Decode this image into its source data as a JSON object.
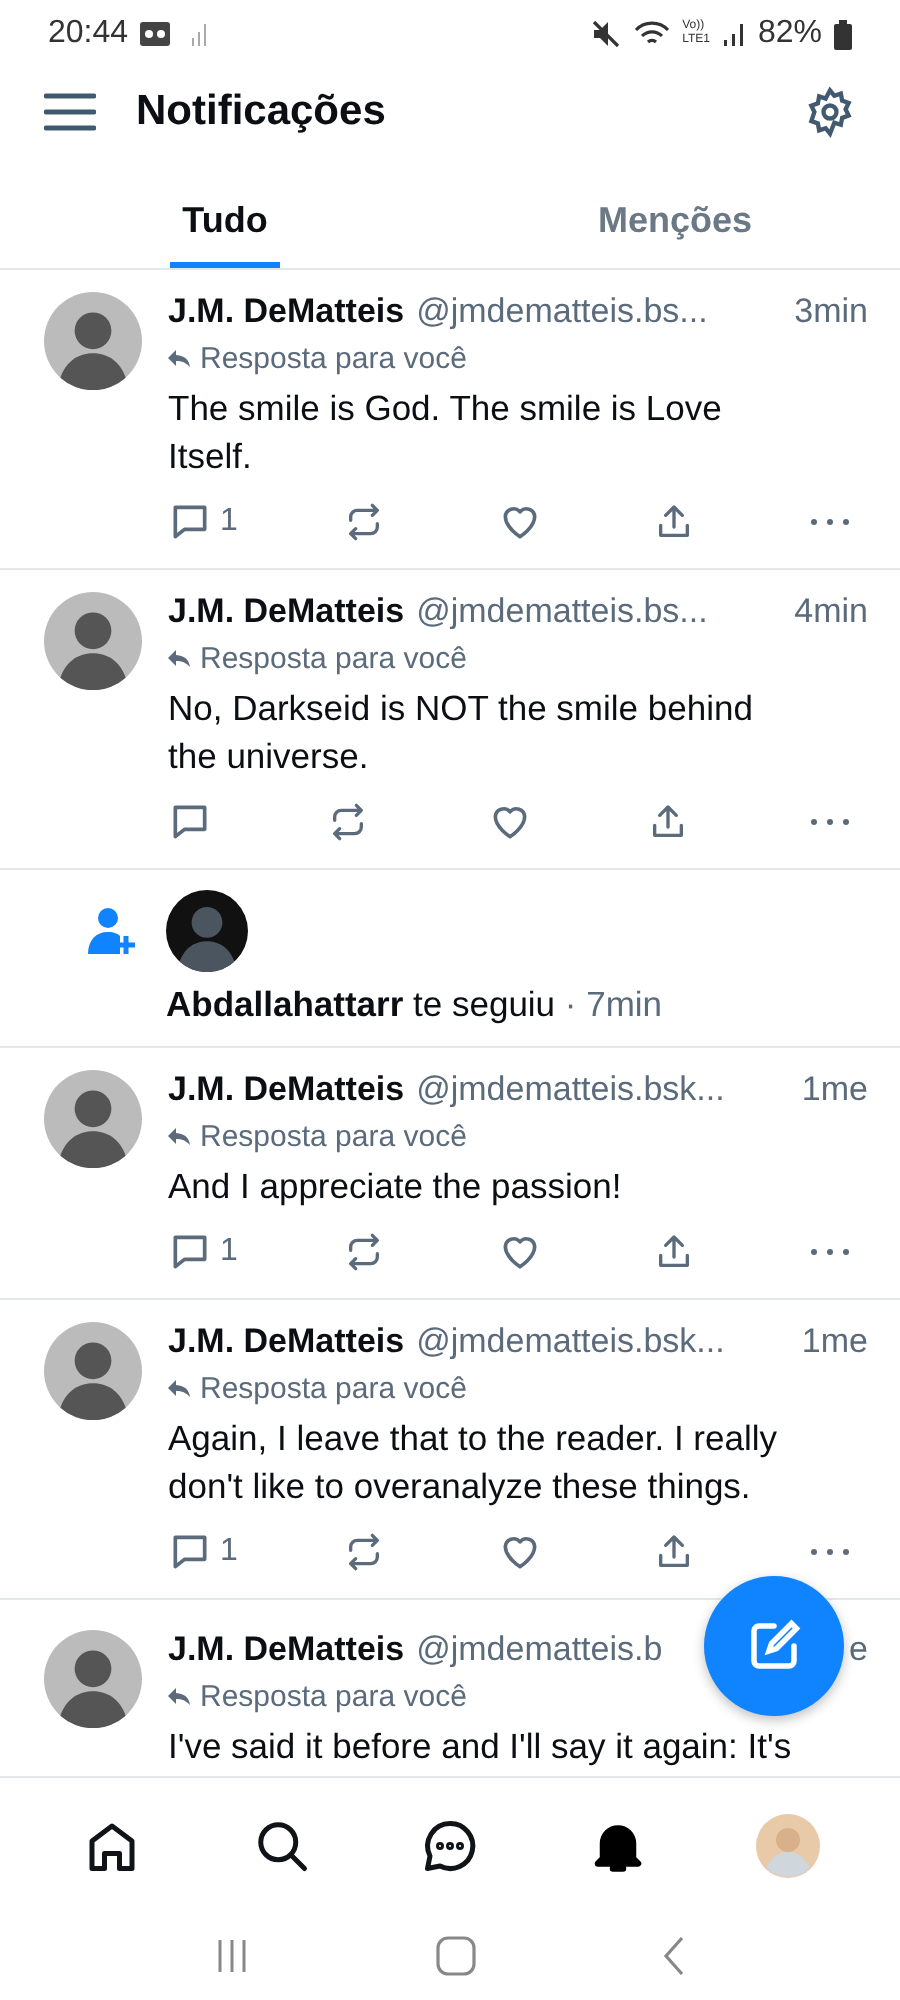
{
  "status_bar": {
    "time": "20:44",
    "volte_top": "Vo))",
    "volte_bottom": "LTE1",
    "battery": "82%"
  },
  "header": {
    "title": "Notificações"
  },
  "tabs": [
    {
      "label": "Tudo",
      "selected": true
    },
    {
      "label": "Menções",
      "selected": false
    }
  ],
  "feed": [
    {
      "kind": "post",
      "author": "J.M. DeMatteis",
      "handle": "@jmdematteis.bs...",
      "time": "3min",
      "context": "Resposta para você",
      "text": "The smile is God.  The smile is Love Itself.",
      "replies": "1"
    },
    {
      "kind": "post",
      "author": "J.M. DeMatteis",
      "handle": "@jmdematteis.bs...",
      "time": "4min",
      "context": "Resposta para você",
      "text": "No, Darkseid is NOT the smile behind the universe."
    },
    {
      "kind": "follow",
      "author": "Abdallahattarr",
      "action": "te seguiu",
      "time": "· 7min"
    },
    {
      "kind": "post",
      "author": "J.M. DeMatteis",
      "handle": "@jmdematteis.bsk...",
      "time": "1me",
      "context": "Resposta para você",
      "text": "And I appreciate the passion!",
      "replies": "1"
    },
    {
      "kind": "post",
      "author": "J.M. DeMatteis",
      "handle": "@jmdematteis.bsk...",
      "time": "1me",
      "context": "Resposta para você",
      "text": "Again, I leave that to the reader.  I really don't like to overanalyze these things.",
      "replies": "1"
    },
    {
      "kind": "cut",
      "author": "J.M. DeMatteis",
      "handle": "@jmdematteis.b",
      "time": "e",
      "context": "Resposta para você",
      "text": "I've said it before and I'll say it again: It's"
    }
  ],
  "bottom_nav": [
    {
      "kind": "home",
      "selected": false
    },
    {
      "kind": "search",
      "selected": false
    },
    {
      "kind": "chat",
      "selected": false
    },
    {
      "kind": "bell",
      "selected": true
    },
    {
      "kind": "profile",
      "selected": false
    }
  ]
}
